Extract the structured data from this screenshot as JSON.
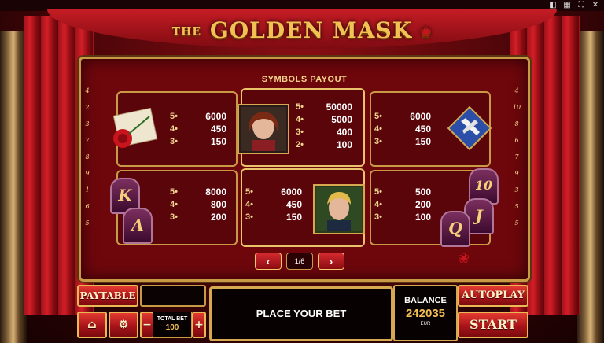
{
  "title": {
    "prefix": "THE",
    "main": "GOLDEN MASK"
  },
  "paytable": {
    "heading": "SYMBOLS PAYOUT",
    "left_lines": [
      "4",
      "2",
      "3",
      "7",
      "8",
      "9",
      "1",
      "6",
      "5"
    ],
    "right_lines": [
      "4",
      "10",
      "8",
      "6",
      "7",
      "9",
      "3",
      "5",
      "5"
    ],
    "boxes": [
      {
        "name": "rose-letter",
        "rows": [
          {
            "k": "5",
            "v": "6000"
          },
          {
            "k": "4",
            "v": "450"
          },
          {
            "k": "3",
            "v": "150"
          }
        ]
      },
      {
        "name": "lady",
        "rows": [
          {
            "k": "5",
            "v": "50000"
          },
          {
            "k": "4",
            "v": "5000"
          },
          {
            "k": "3",
            "v": "400"
          },
          {
            "k": "2",
            "v": "100"
          }
        ]
      },
      {
        "name": "gloves",
        "rows": [
          {
            "k": "5",
            "v": "6000"
          },
          {
            "k": "4",
            "v": "450"
          },
          {
            "k": "3",
            "v": "150"
          }
        ]
      },
      {
        "name": "k-a",
        "rows": [
          {
            "k": "5",
            "v": "8000"
          },
          {
            "k": "4",
            "v": "800"
          },
          {
            "k": "3",
            "v": "200"
          }
        ]
      },
      {
        "name": "man",
        "rows": [
          {
            "k": "5",
            "v": "6000"
          },
          {
            "k": "4",
            "v": "450"
          },
          {
            "k": "3",
            "v": "150"
          }
        ]
      },
      {
        "name": "10-j-q",
        "rows": [
          {
            "k": "5",
            "v": "500"
          },
          {
            "k": "4",
            "v": "200"
          },
          {
            "k": "3",
            "v": "100"
          }
        ]
      }
    ],
    "letters": {
      "k": "K",
      "a": "A",
      "ten": "10",
      "j": "J",
      "q": "Q"
    },
    "page": "1/6"
  },
  "controls": {
    "paytable": "PAYTABLE",
    "autoplay": "AUTOPLAY",
    "start": "START",
    "message": "PLACE YOUR BET",
    "total_bet_label": "TOTAL BET",
    "total_bet_value": "100",
    "balance_label": "BALANCE",
    "balance_value": "242035",
    "currency": "EUR",
    "minus": "−",
    "plus": "+"
  },
  "icons": [
    "home-icon",
    "gear-icon",
    "prev-icon",
    "next-icon",
    "sound-icon",
    "fullscreen-icon",
    "close-icon"
  ]
}
